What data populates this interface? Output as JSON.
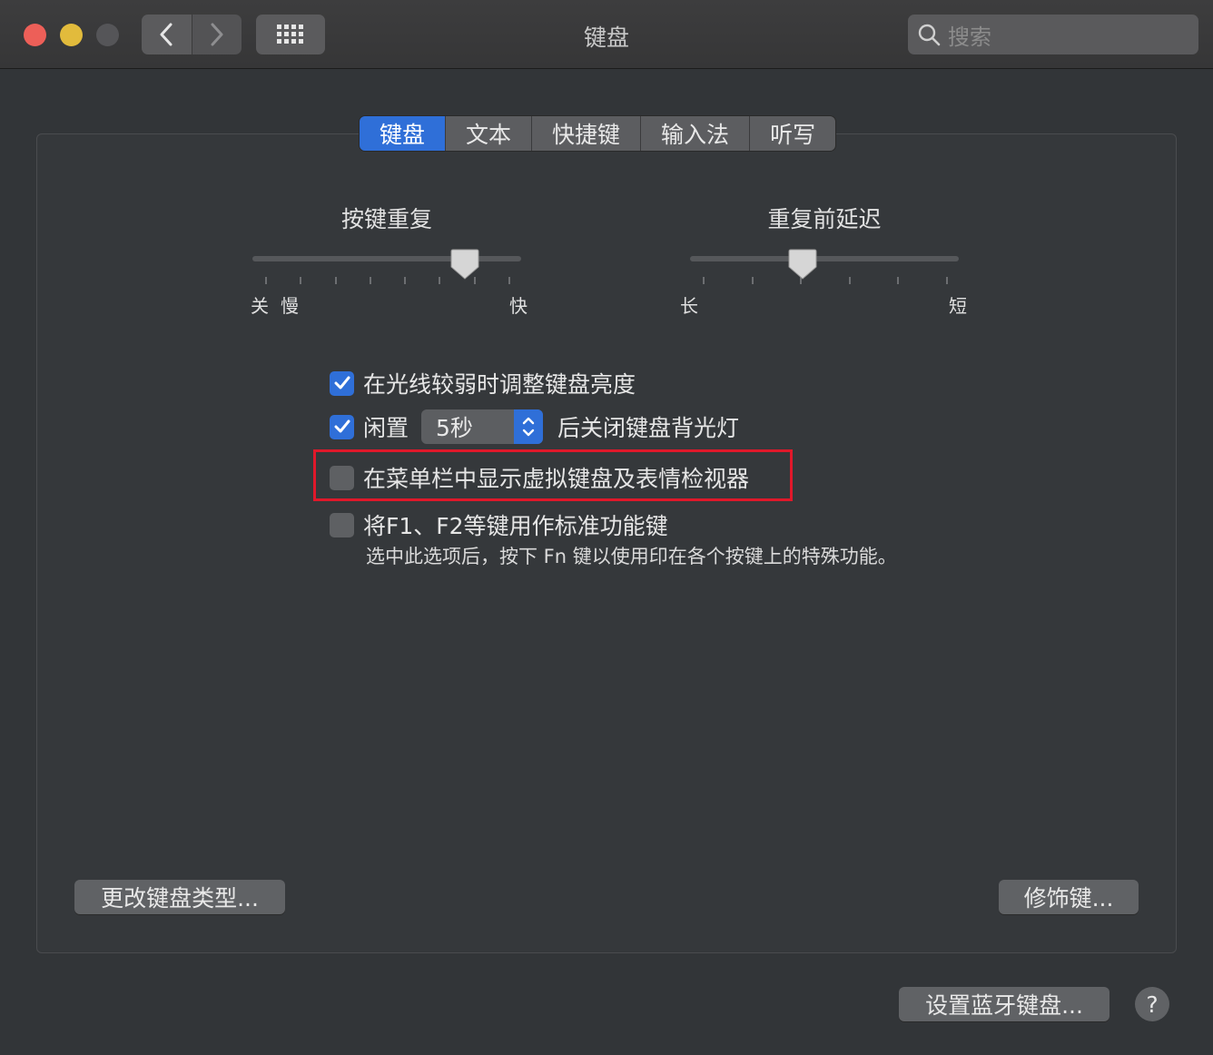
{
  "window": {
    "title": "键盘",
    "search_placeholder": "搜索"
  },
  "tabs": [
    {
      "label": "键盘",
      "active": true
    },
    {
      "label": "文本",
      "active": false
    },
    {
      "label": "快捷键",
      "active": false
    },
    {
      "label": "输入法",
      "active": false
    },
    {
      "label": "听写",
      "active": false
    }
  ],
  "sliders": {
    "key_repeat": {
      "title": "按键重复",
      "label_off": "关",
      "label_slow": "慢",
      "label_fast": "快",
      "level": 0.82
    },
    "delay": {
      "title": "重复前延迟",
      "label_long": "长",
      "label_short": "短",
      "level": 0.41
    }
  },
  "options": {
    "adjust_brightness": {
      "label": "在光线较弱时调整键盘亮度",
      "checked": true
    },
    "idle": {
      "prefix": "闲置",
      "value": "5秒",
      "suffix": "后关闭键盘背光灯",
      "checked": true
    },
    "show_viewer": {
      "label": "在菜单栏中显示虚拟键盘及表情检视器",
      "checked": false
    },
    "fn_keys": {
      "label": "将F1、F2等键用作标准功能键",
      "checked": false,
      "description": "选中此选项后，按下 Fn 键以使用印在各个按键上的特殊功能。"
    }
  },
  "buttons": {
    "change_type": "更改键盘类型...",
    "modifier": "修饰键...",
    "bluetooth": "设置蓝牙键盘...",
    "help": "?"
  },
  "colors": {
    "accent": "#2f6fd8",
    "highlight": "#e0182a"
  }
}
